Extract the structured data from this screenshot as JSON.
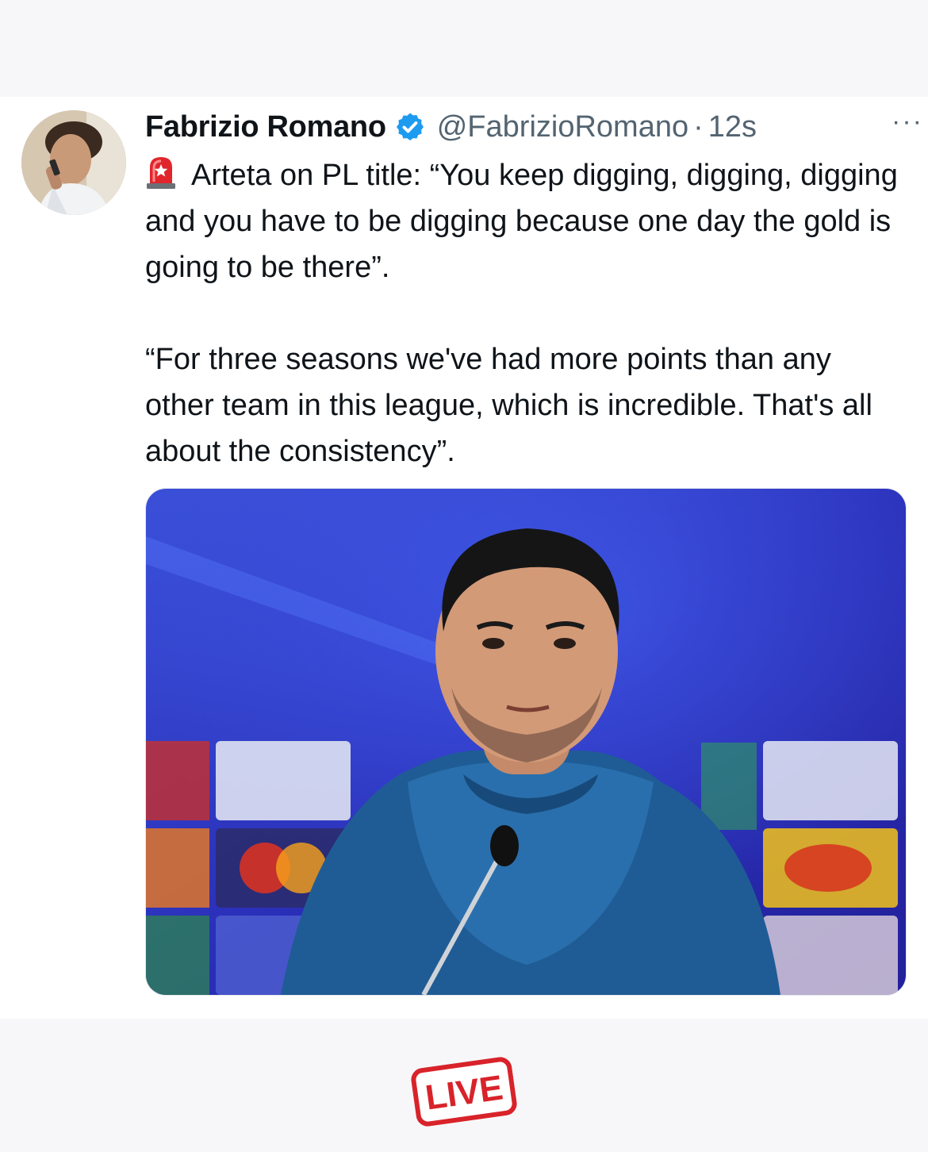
{
  "tweet": {
    "author_name": "Fabrizio Romano",
    "handle": "@FabrizioRomano",
    "separator": "·",
    "time": "12s",
    "more_label": "···",
    "paragraphs": [
      "Arteta on PL title: “You keep digging, digging, digging and you have to be digging because one day the gold is going to be there”.",
      "“For three seasons we've had more points than any other team in this league,  which is incredible. That's all about the consistency”."
    ],
    "leading_emoji": "siren-icon"
  },
  "footer": {
    "badge_label": "LIVE"
  },
  "colors": {
    "verified": "#1d9bf0",
    "text_primary": "#0f1419",
    "text_secondary": "#536471",
    "badge_red": "#d8232a"
  }
}
